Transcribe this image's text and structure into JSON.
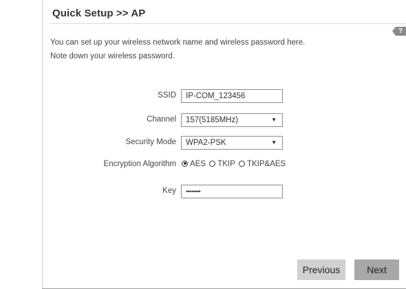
{
  "header": {
    "title": "Quick Setup >> AP",
    "help_label": "?"
  },
  "description": {
    "line1": "You can set up your wireless network name and wireless password here.",
    "line2": "Note down your wireless password."
  },
  "form": {
    "ssid": {
      "label": "SSID",
      "value": "IP-COM_123456"
    },
    "channel": {
      "label": "Channel",
      "value": "157(5185MHz)"
    },
    "security_mode": {
      "label": "Security Mode",
      "value": "WPA2-PSK"
    },
    "encryption": {
      "label": "Encryption Algorithm",
      "options": [
        "AES",
        "TKIP",
        "TKIP&AES"
      ],
      "selected": "AES"
    },
    "key": {
      "label": "Key",
      "value": "••••••••"
    }
  },
  "buttons": {
    "previous": "Previous",
    "next": "Next"
  },
  "colors": {
    "next_button": "#a8a8a8",
    "previous_button": "#d0d0d0",
    "help_badge": "#8a8a8a"
  }
}
